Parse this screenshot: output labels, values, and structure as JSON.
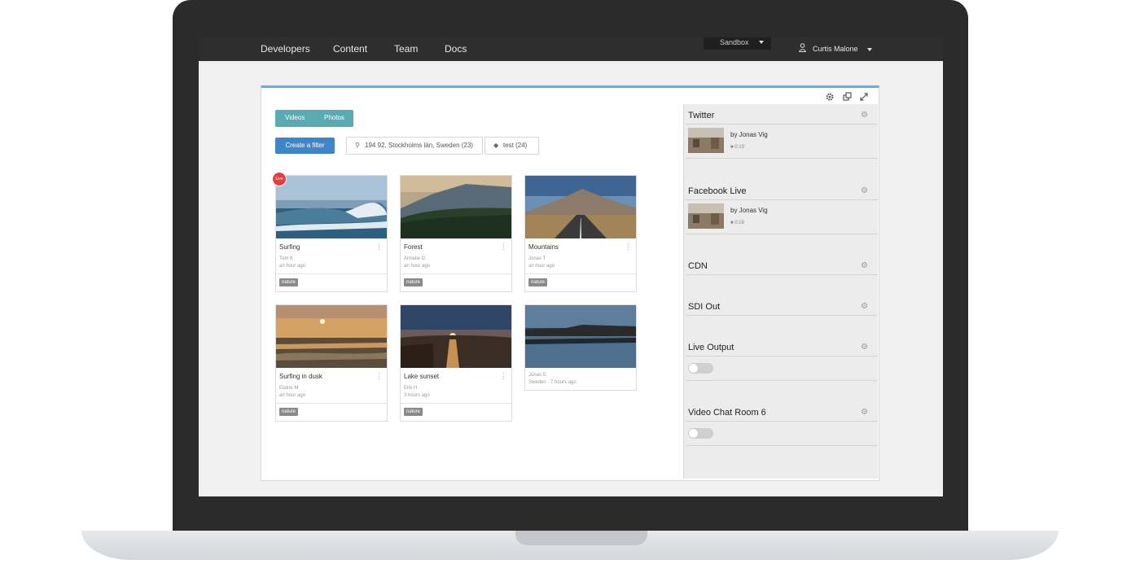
{
  "nav": {
    "links": [
      "Developers",
      "Content",
      "Team",
      "Docs"
    ],
    "environment": "Sandbox",
    "user": "Curtis Malone"
  },
  "toolbar": {
    "icons": [
      "gear-icon",
      "popout-icon",
      "expand-icon"
    ]
  },
  "media_toggle": {
    "videos": "Videos",
    "photos": "Photos",
    "active": "Photos"
  },
  "filters": {
    "create_label": "Create a filter",
    "location": "194 92, Stockholms län, Sweden (23)",
    "tag": "test (24)"
  },
  "cards": [
    {
      "title": "Surfing",
      "author": "Tom K",
      "time": "an hour ago",
      "tag": "nature",
      "live": "Live"
    },
    {
      "title": "Forest",
      "author": "Annelie D",
      "time": "an hour ago",
      "tag": "nature"
    },
    {
      "title": "Mountains",
      "author": "Jonas T",
      "time": "an hour ago",
      "tag": "nature"
    },
    {
      "title": "Surfing in dusk",
      "author": "Elaine M",
      "time": "an hour ago",
      "tag": "nature"
    },
    {
      "title": "Lake sunset",
      "author": "Erik H",
      "time": "3 hours ago",
      "tag": "nature"
    },
    {
      "title": "",
      "author": "Jonas S",
      "time": "Sweden · 7 hours ago"
    }
  ],
  "sidebar": {
    "sections": [
      {
        "title": "Twitter",
        "item": {
          "by": "by Jonas Vig",
          "duration": "0:19"
        }
      },
      {
        "title": "Facebook Live",
        "item": {
          "by": "by Jonas Vig",
          "duration": "0:19"
        }
      },
      {
        "title": "CDN"
      },
      {
        "title": "SDI Out"
      },
      {
        "title": "Live Output",
        "toggle": "off"
      },
      {
        "title": "Video Chat Room 6",
        "toggle": "off"
      }
    ]
  },
  "colors": {
    "nav_bg": "#2e2e2e",
    "accent_blue": "#3f86c8",
    "segment_teal": "#5aaab4",
    "panel_top": "#5bb4e0",
    "live_red": "#e04040"
  }
}
